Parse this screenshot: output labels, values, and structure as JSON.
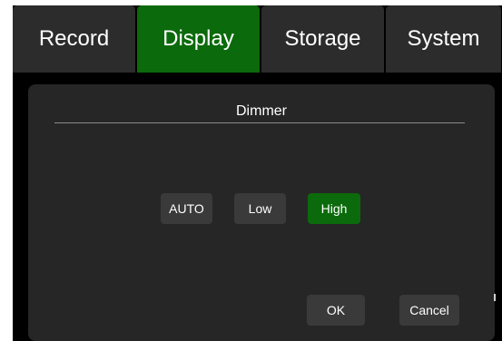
{
  "tabs": [
    {
      "label": "Record",
      "active": false
    },
    {
      "label": "Display",
      "active": true
    },
    {
      "label": "Storage",
      "active": false
    },
    {
      "label": "System",
      "active": false
    }
  ],
  "dialog": {
    "title": "Dimmer",
    "options": [
      {
        "label": "AUTO",
        "selected": false
      },
      {
        "label": "Low",
        "selected": false
      },
      {
        "label": "High",
        "selected": true
      }
    ],
    "ok_label": "OK",
    "cancel_label": "Cancel"
  },
  "colors": {
    "screen_background": "#000000",
    "tab_background": "#2c2c2c",
    "accent_green": "#0b6a0b",
    "panel_background": "#262626",
    "button_background": "#3a3a3a",
    "text": "#ffffff"
  }
}
